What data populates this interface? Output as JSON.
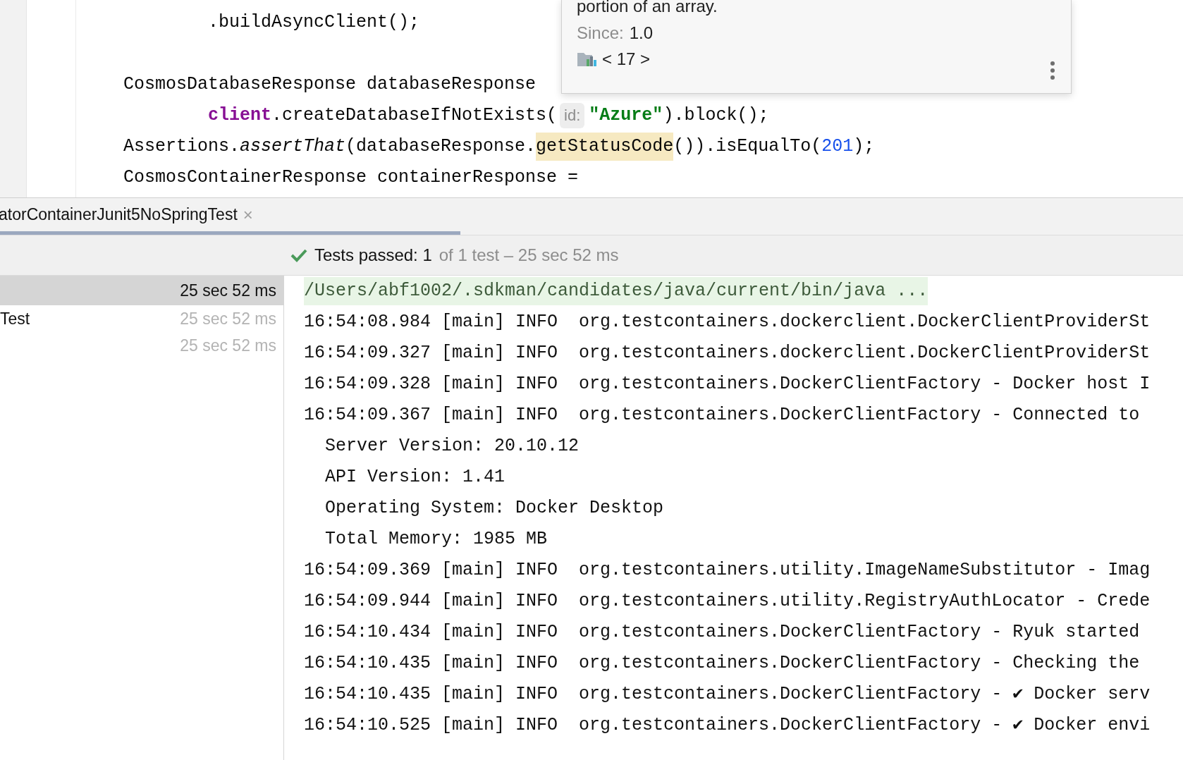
{
  "editor": {
    "lines": [
      {
        "kind": "continuation",
        "segments": [
          {
            "kind": "plain",
            "text": ".buildAsyncClient();"
          }
        ]
      },
      {
        "kind": "blank"
      },
      {
        "kind": "statement",
        "segments": [
          {
            "kind": "plain",
            "text": "CosmosDatabaseResponse databaseResponse"
          }
        ]
      },
      {
        "kind": "continuation",
        "segments": [
          {
            "kind": "field",
            "text": "client"
          },
          {
            "kind": "plain",
            "text": ".createDatabaseIfNotExists("
          },
          {
            "kind": "hint",
            "text": "id:"
          },
          {
            "kind": "string",
            "text": "\"Azure\""
          },
          {
            "kind": "plain",
            "text": ").block();"
          }
        ]
      },
      {
        "kind": "statement",
        "segments": [
          {
            "kind": "plain",
            "text": "Assertions."
          },
          {
            "kind": "static",
            "text": "assertThat"
          },
          {
            "kind": "plain",
            "text": "(databaseResponse."
          },
          {
            "kind": "usage",
            "text": "getStatusCode"
          },
          {
            "kind": "plain",
            "text": "()).isEqualTo("
          },
          {
            "kind": "number",
            "text": "201"
          },
          {
            "kind": "plain",
            "text": ");"
          }
        ]
      },
      {
        "kind": "statement",
        "segments": [
          {
            "kind": "plain",
            "text": "CosmosContainerResponse containerResponse ="
          }
        ]
      }
    ]
  },
  "doc_popup": {
    "text": "portion of an array.",
    "since_label": "Since:",
    "since_value": "1.0",
    "library": "< 17 >"
  },
  "run_tab": {
    "title": "atorContainerJunit5NoSpringTest",
    "close": "×"
  },
  "test_status": {
    "passed": "Tests passed: 1",
    "rest": "of 1 test – 25 sec 52 ms"
  },
  "tree": {
    "rows": [
      {
        "selected": true,
        "time": "25 sec 52 ms"
      },
      {
        "selected": false,
        "label": "Test",
        "time": "25 sec 52 ms"
      },
      {
        "selected": false,
        "time": "25 sec 52 ms"
      }
    ]
  },
  "console": {
    "lines": [
      {
        "kind": "command",
        "text": "/Users/abf1002/.sdkman/candidates/java/current/bin/java ..."
      },
      {
        "kind": "log",
        "text": "16:54:08.984 [main] INFO  org.testcontainers.dockerclient.DockerClientProviderSt"
      },
      {
        "kind": "log",
        "text": "16:54:09.327 [main] INFO  org.testcontainers.dockerclient.DockerClientProviderSt"
      },
      {
        "kind": "log",
        "text": "16:54:09.328 [main] INFO  org.testcontainers.DockerClientFactory - Docker host I"
      },
      {
        "kind": "log",
        "text": "16:54:09.367 [main] INFO  org.testcontainers.DockerClientFactory - Connected to"
      },
      {
        "kind": "detail",
        "text": "Server Version: 20.10.12"
      },
      {
        "kind": "detail",
        "text": "API Version: 1.41"
      },
      {
        "kind": "detail",
        "text": "Operating System: Docker Desktop"
      },
      {
        "kind": "detail",
        "text": "Total Memory: 1985 MB"
      },
      {
        "kind": "log",
        "text": "16:54:09.369 [main] INFO  org.testcontainers.utility.ImageNameSubstitutor - Imag"
      },
      {
        "kind": "log",
        "text": "16:54:09.944 [main] INFO  org.testcontainers.utility.RegistryAuthLocator - Crede"
      },
      {
        "kind": "log",
        "text": "16:54:10.434 [main] INFO  org.testcontainers.DockerClientFactory - Ryuk started"
      },
      {
        "kind": "log",
        "text": "16:54:10.435 [main] INFO  org.testcontainers.DockerClientFactory - Checking the"
      },
      {
        "kind": "log",
        "text": "16:54:10.435 [main] INFO  org.testcontainers.DockerClientFactory - ✔ Docker serv"
      },
      {
        "kind": "log",
        "text": "16:54:10.525 [main] INFO  org.testcontainers.DockerClientFactory - ✔ Docker envi"
      }
    ]
  }
}
